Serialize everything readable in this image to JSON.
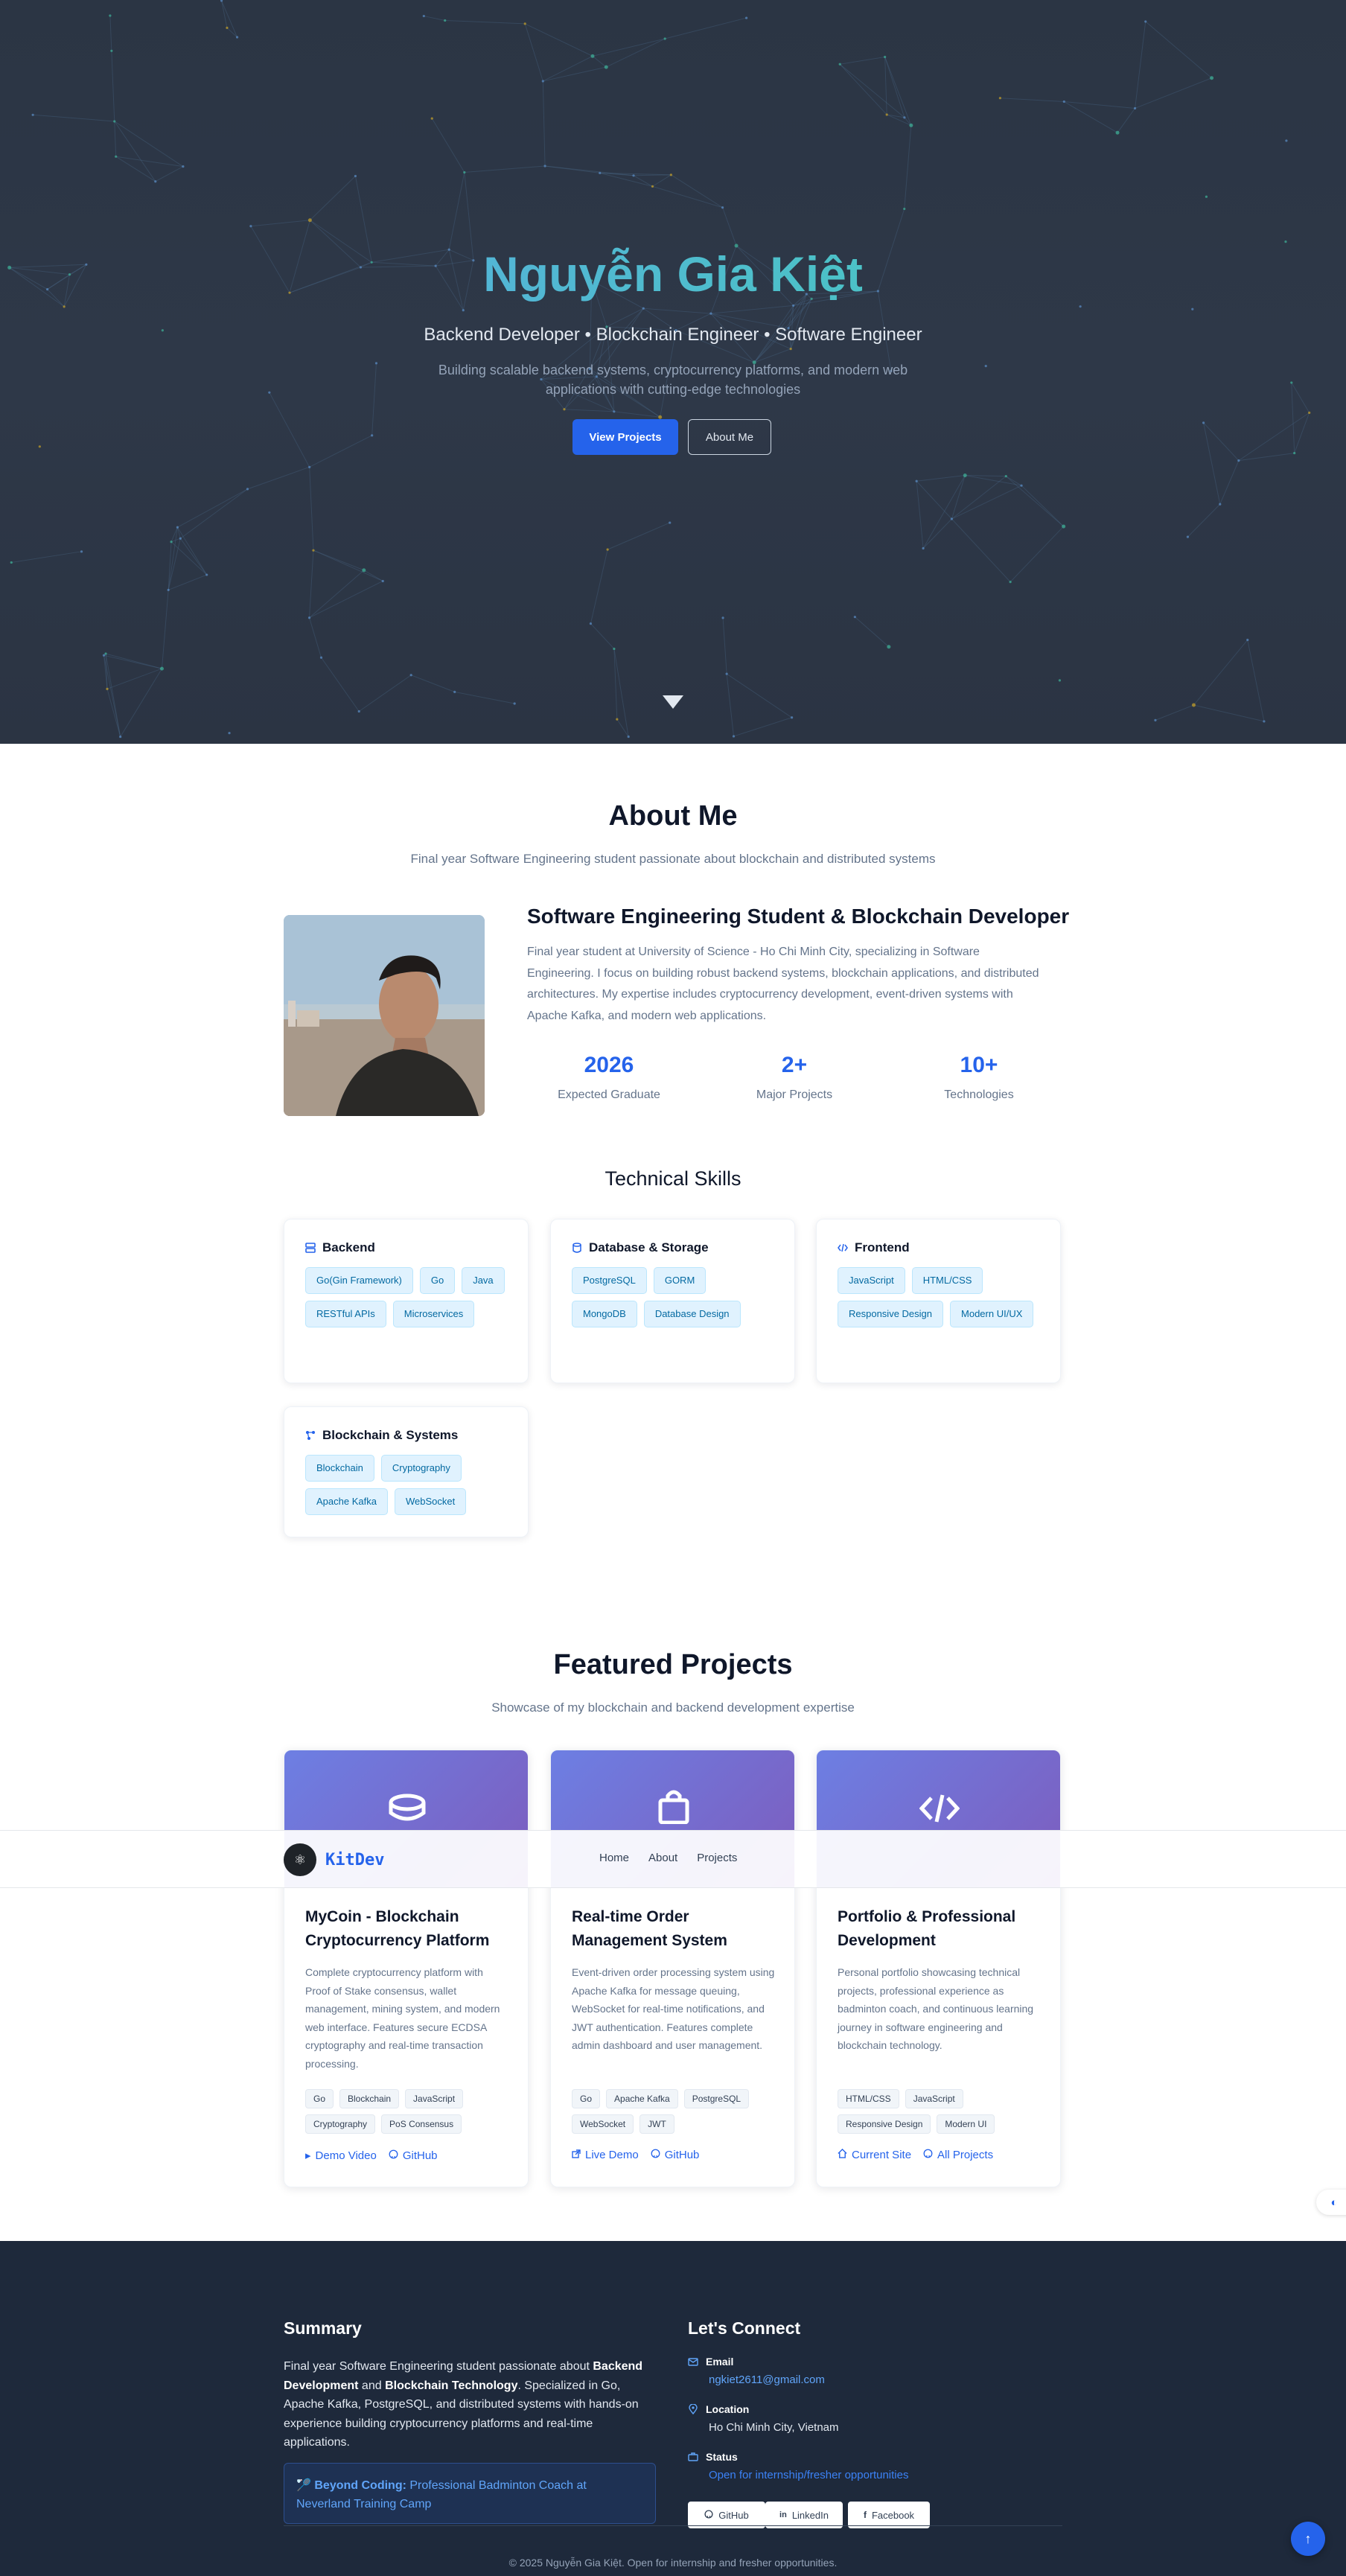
{
  "hero": {
    "title": "Nguyễn Gia Kiệt",
    "subtitle": "Backend Developer • Blockchain Engineer • Software Engineer",
    "description": "Building scalable backend systems, cryptocurrency platforms, and modern web applications with cutting-edge technologies",
    "primary_button": "View Projects",
    "secondary_button": "About Me"
  },
  "about": {
    "heading": "About Me",
    "subheading": "Final year Software Engineering student passionate about blockchain and distributed systems",
    "title": "Software Engineering Student & Blockchain Developer",
    "text": "Final year student at University of Science - Ho Chi Minh City, specializing in Software Engineering. I focus on building robust backend systems, blockchain applications, and distributed architectures. My expertise includes cryptocurrency development, event-driven systems with Apache Kafka, and modern web applications.",
    "stats": [
      {
        "value": "2026",
        "label": "Expected Graduate"
      },
      {
        "value": "2+",
        "label": "Major Projects"
      },
      {
        "value": "10+",
        "label": "Technologies"
      }
    ]
  },
  "skills": {
    "heading": "Technical Skills",
    "groups": [
      {
        "title": "Backend",
        "icon": "server-icon",
        "tags": [
          "Go(Gin Framework)",
          "Go",
          "Java",
          "RESTful APIs",
          "Microservices"
        ]
      },
      {
        "title": "Database & Storage",
        "icon": "database-icon",
        "tags": [
          "PostgreSQL",
          "GORM",
          "MongoDB",
          "Database Design"
        ]
      },
      {
        "title": "Frontend",
        "icon": "code-icon",
        "tags": [
          "JavaScript",
          "HTML/CSS",
          "Responsive Design",
          "Modern UI/UX"
        ]
      },
      {
        "title": "Blockchain & Systems",
        "icon": "network-icon",
        "tags": [
          "Blockchain",
          "Cryptography",
          "Apache Kafka",
          "WebSocket"
        ]
      }
    ]
  },
  "projects": {
    "heading": "Featured Projects",
    "subheading": "Showcase of my blockchain and backend development expertise",
    "items": [
      {
        "title": "MyCoin - Blockchain Cryptocurrency Platform",
        "icon": "coins-icon",
        "description": "Complete cryptocurrency platform with Proof of Stake consensus, wallet management, mining system, and modern web interface. Features secure ECDSA cryptography and real-time transaction processing.",
        "tags": [
          "Go",
          "Blockchain",
          "JavaScript",
          "Cryptography",
          "PoS Consensus"
        ],
        "links": [
          {
            "label": "Demo Video",
            "icon": "play-icon"
          },
          {
            "label": "GitHub",
            "icon": "github-icon"
          }
        ]
      },
      {
        "title": "Real-time Order Management System",
        "icon": "shopping-bag-icon",
        "description": "Event-driven order processing system using Apache Kafka for message queuing, WebSocket for real-time notifications, and JWT authentication. Features complete admin dashboard and user management.",
        "tags": [
          "Go",
          "Apache Kafka",
          "PostgreSQL",
          "WebSocket",
          "JWT"
        ],
        "links": [
          {
            "label": "Live Demo",
            "icon": "external-link-icon"
          },
          {
            "label": "GitHub",
            "icon": "github-icon"
          }
        ]
      },
      {
        "title": "Portfolio & Professional Development",
        "icon": "code-icon",
        "description": "Personal portfolio showcasing technical projects, professional experience as badminton coach, and continuous learning journey in software engineering and blockchain technology.",
        "tags": [
          "HTML/CSS",
          "JavaScript",
          "Responsive Design",
          "Modern UI"
        ],
        "links": [
          {
            "label": "Current Site",
            "icon": "home-icon"
          },
          {
            "label": "All Projects",
            "icon": "github-icon"
          }
        ]
      }
    ]
  },
  "navbar": {
    "brand": "KitDev",
    "links": [
      "Home",
      "About",
      "Projects"
    ]
  },
  "footer": {
    "summary_heading": "Summary",
    "summary_parts": [
      "Final year Software Engineering student passionate about ",
      "Backend Development",
      " and ",
      "Blockchain Technology",
      ". Specialized in Go, Apache Kafka, PostgreSQL, and distributed systems with hands-on experience building cryptocurrency platforms and real-time applications."
    ],
    "beyond_label": "Beyond Coding:",
    "beyond_text": " Professional Badminton Coach at Neverland Training Camp",
    "connect_heading": "Let's Connect",
    "contacts": [
      {
        "label": "Email",
        "value": "ngkiet2611@gmail.com",
        "icon": "mail-icon",
        "color": "#60a5fa"
      },
      {
        "label": "Location",
        "value": "Ho Chi Minh City, Vietnam",
        "icon": "map-pin-icon",
        "color": "#e2e8f0"
      },
      {
        "label": "Status",
        "value": "Open for internship/fresher opportunities",
        "icon": "briefcase-icon",
        "color": "#3b82f6"
      }
    ],
    "socials": [
      {
        "label": "GitHub",
        "icon": "github-icon"
      },
      {
        "label": "LinkedIn",
        "icon": "linkedin-icon"
      },
      {
        "label": "Facebook",
        "icon": "facebook-icon"
      }
    ],
    "copyright": "© 2025 Nguyễn Gia Kiệt. Open for internship and fresher opportunities."
  },
  "colors": {
    "accent": "#2563eb",
    "hero_bg": "#2e3848",
    "footer_bg": "#1e293b",
    "project_gradient_start": "#6d7fe3",
    "project_gradient_end": "#7d5cbd"
  }
}
